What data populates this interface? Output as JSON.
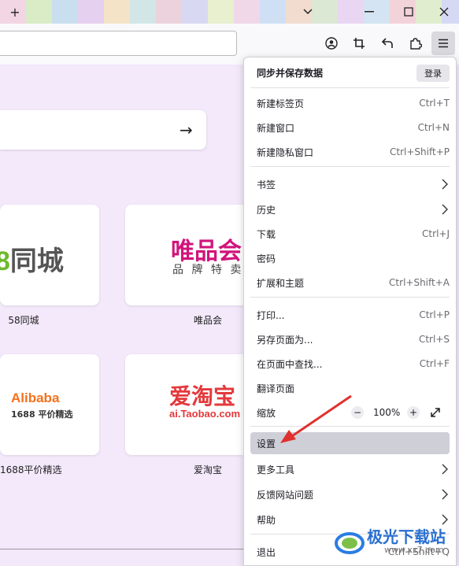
{
  "titlebar": {
    "new_tab": "+",
    "dropdown": "⌄",
    "maximize": "□",
    "close": "✕",
    "pixel_colors": [
      "#f2d6e3",
      "#d9ecc6",
      "#c9dff0",
      "#e6d0f0",
      "#f5e3c7",
      "#d2e6e8",
      "#ecd2dc",
      "#d8d8f2",
      "#e8f0d0",
      "#f0d8e8",
      "#cfe0f5",
      "#f1dccf",
      "#dbe8d4",
      "#e9d6f3",
      "#d4e4f2",
      "#f3d3da",
      "#e0eecf",
      "#d6d9f3"
    ]
  },
  "toolbar": {
    "icons": [
      "account-icon",
      "crop-icon",
      "back-arrow-icon",
      "extensions-icon",
      "hamburger-menu-icon"
    ]
  },
  "search": {
    "arrow": "→"
  },
  "tiles": [
    {
      "label": "58同城",
      "logo": "8同城"
    },
    {
      "label": "唯品会",
      "logo_top": "唯品会",
      "logo_bottom": "品 牌 特 卖"
    },
    {
      "label": "1688平价精选",
      "logo_top": "Alibaba",
      "logo_bottom": "1688 平价精选"
    },
    {
      "label": "爱淘宝",
      "logo_top": "爱淘宝",
      "logo_bottom": "ai.Taobao.com"
    }
  ],
  "menu": {
    "sync_title": "同步并保存数据",
    "login": "登录",
    "items": [
      {
        "label": "新建标签页",
        "shortcut": "Ctrl+T"
      },
      {
        "label": "新建窗口",
        "shortcut": "Ctrl+N"
      },
      {
        "label": "新建隐私窗口",
        "shortcut": "Ctrl+Shift+P"
      },
      {
        "label": "书签",
        "shortcut": ""
      },
      {
        "label": "历史",
        "shortcut": ""
      },
      {
        "label": "下载",
        "shortcut": "Ctrl+J"
      },
      {
        "label": "密码",
        "shortcut": ""
      },
      {
        "label": "扩展和主题",
        "shortcut": "Ctrl+Shift+A"
      },
      {
        "label": "打印...",
        "shortcut": "Ctrl+P"
      },
      {
        "label": "另存页面为...",
        "shortcut": "Ctrl+S"
      },
      {
        "label": "在页面中查找...",
        "shortcut": "Ctrl+F"
      },
      {
        "label": "翻译页面",
        "shortcut": ""
      },
      {
        "label": "缩放",
        "shortcut": ""
      },
      {
        "label": "设置",
        "shortcut": ""
      },
      {
        "label": "更多工具",
        "shortcut": ""
      },
      {
        "label": "反馈网站问题",
        "shortcut": ""
      },
      {
        "label": "帮助",
        "shortcut": ""
      },
      {
        "label": "退出",
        "shortcut": "Ctrl+Shift+Q"
      }
    ],
    "zoom": {
      "minus": "−",
      "value": "100%",
      "plus": "+"
    }
  },
  "watermark": {
    "title": "极光下载站",
    "url": "www.xz7.com"
  },
  "colors": {
    "highlight": "#cfcfd8",
    "arrow": "#e0312e",
    "taobao": "#e4393c",
    "alibaba": "#f5701a",
    "vip": "#d1147c"
  }
}
